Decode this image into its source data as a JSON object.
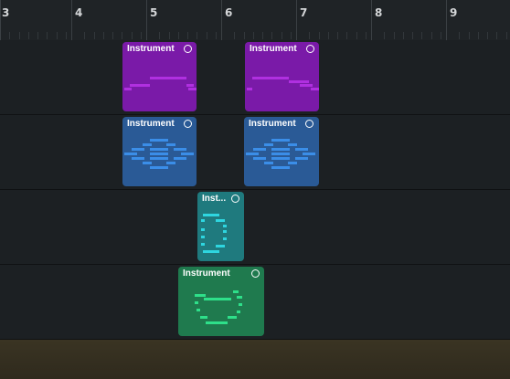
{
  "timeline": {
    "bars": [
      "3",
      "4",
      "5",
      "6",
      "7",
      "8",
      "9"
    ]
  },
  "colors": {
    "purple": "#7a1aa8",
    "blue": "#2a5a96",
    "teal": "#1f7a7e",
    "green": "#1f7a4e",
    "lane_bg": "#1c2023"
  },
  "tracks": [
    {
      "clips": [
        {
          "title": "Instrument",
          "color": "purple",
          "icon": "loop-icon"
        },
        {
          "title": "Instrument",
          "color": "purple",
          "icon": "loop-icon"
        }
      ]
    },
    {
      "clips": [
        {
          "title": "Instrument",
          "color": "blue",
          "icon": "loop-icon"
        },
        {
          "title": "Instrument",
          "color": "blue",
          "icon": "loop-icon"
        }
      ]
    },
    {
      "clips": [
        {
          "title": "Inst...",
          "color": "teal",
          "icon": "loop-icon"
        }
      ]
    },
    {
      "clips": [
        {
          "title": "Instrument",
          "color": "green",
          "icon": "loop-icon"
        }
      ]
    }
  ]
}
